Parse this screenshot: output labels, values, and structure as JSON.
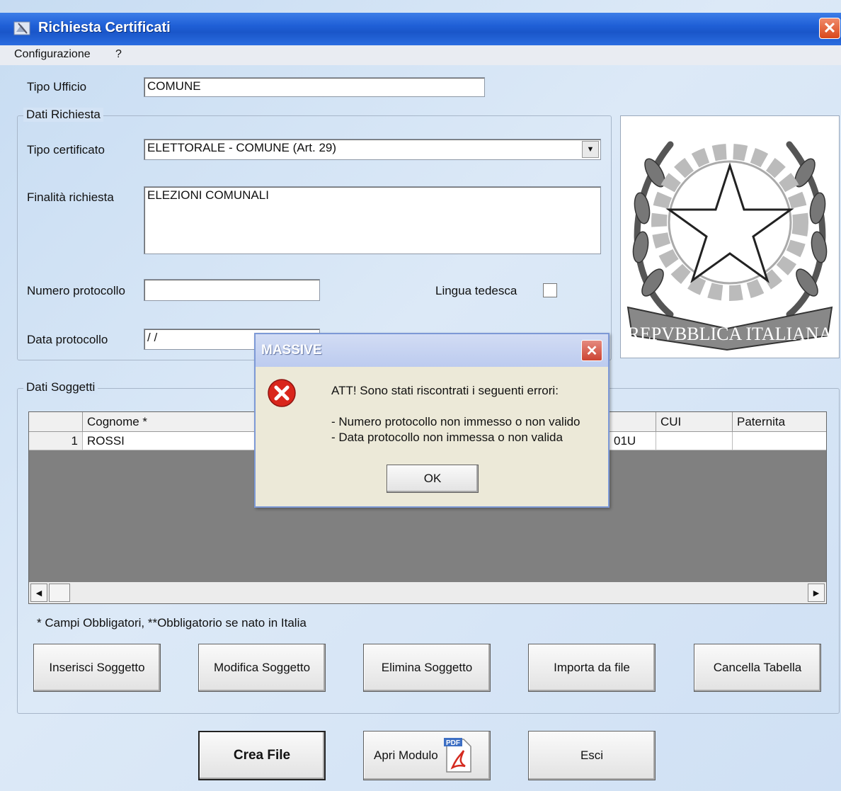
{
  "window": {
    "title": "Richiesta Certificati"
  },
  "menu": {
    "items": [
      "Configurazione",
      "?"
    ]
  },
  "form": {
    "tipo_ufficio_label": "Tipo Ufficio",
    "tipo_ufficio_value": "COMUNE",
    "dati_richiesta_title": "Dati Richiesta",
    "tipo_certificato_label": "Tipo certificato",
    "tipo_certificato_value": "ELETTORALE - COMUNE (Art. 29)",
    "finalita_label": "Finalità richiesta",
    "finalita_value": "ELEZIONI COMUNALI",
    "numero_protocollo_label": "Numero protocollo",
    "numero_protocollo_value": "",
    "lingua_tedesca_label": "Lingua tedesca",
    "data_protocollo_label": "Data protocollo",
    "data_protocollo_value": " / /"
  },
  "emblem": {
    "text": "REPVBBLICA ITALIANA"
  },
  "soggetti": {
    "title": "Dati Soggetti",
    "columns": [
      "",
      "Cognome *",
      "CUI",
      "Paternita"
    ],
    "rows": [
      {
        "num": "1",
        "cognome": "ROSSI",
        "hidden_fragment": "01U",
        "cui": "",
        "paternita": ""
      }
    ],
    "note": "* Campi Obbligatori, **Obbligatorio se nato in Italia"
  },
  "buttons": {
    "inserisci": "Inserisci Soggetto",
    "modifica": "Modifica Soggetto",
    "elimina": "Elimina Soggetto",
    "importa": "Importa da file",
    "cancella": "Cancella Tabella",
    "crea": "Crea File",
    "apri": "Apri Modulo",
    "esci": "Esci",
    "pdf_badge": "PDF"
  },
  "dialog": {
    "title": "MASSIVE",
    "line1": "ATT! Sono stati riscontrati i seguenti errori:",
    "line2": "- Numero protocollo non immesso o non valido",
    "line3": "- Data protocollo non immessa o non valida",
    "ok": "OK"
  },
  "colors": {
    "titlebar": "#1f5fd6",
    "error_icon": "#d9261c",
    "background": "#d3e3f5"
  }
}
